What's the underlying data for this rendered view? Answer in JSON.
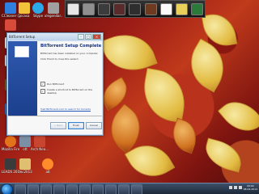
{
  "desktop": {
    "icons": [
      {
        "label": "CCleaner (2)",
        "color": "#2f7fe0"
      },
      {
        "label": "picasa",
        "color": "#f2c238"
      },
      {
        "label": "Skype",
        "color": "#2aa8e8"
      },
      {
        "label": "xlegendar...",
        "color": "#a0a0a0"
      },
      {
        "label": "",
        "color": "#d84a3a"
      },
      {
        "label": "",
        "color": "#f3f3f3"
      },
      {
        "label": "",
        "color": "#d8e0ea"
      },
      {
        "label": "",
        "color": "#7a5a2a"
      },
      {
        "label": "",
        "color": "#3a6ab0"
      },
      {
        "label": "Mozilla Firefox",
        "color": "#e3731b"
      },
      {
        "label": "ott",
        "color": "#7b8fa6"
      },
      {
        "label": "Arch Nea...",
        "color": "#c84630"
      },
      {
        "label": "LEADS 2013",
        "color": "#3b3b3b"
      },
      {
        "label": "dec2013",
        "color": "#e0c070"
      },
      {
        "label": "a8",
        "color": "#ff8c2a"
      }
    ]
  },
  "window": {
    "title": "BitTorrent Setup",
    "heading": "BitTorrent Setup Complete",
    "line1": "BitTorrent has been installed on your computer.",
    "line2": "Click Finish to close this wizard.",
    "check_run": "Run BitTorrent",
    "check_shortcut": "Create a shortcut to BitTorrent on the desktop",
    "link": "Visit BitTorrent.com to search for torrents",
    "back": "< Back",
    "finish": "Finish",
    "cancel": "Cancel"
  },
  "taskbar": {
    "time": "20:02",
    "date": "08-04-2014"
  }
}
